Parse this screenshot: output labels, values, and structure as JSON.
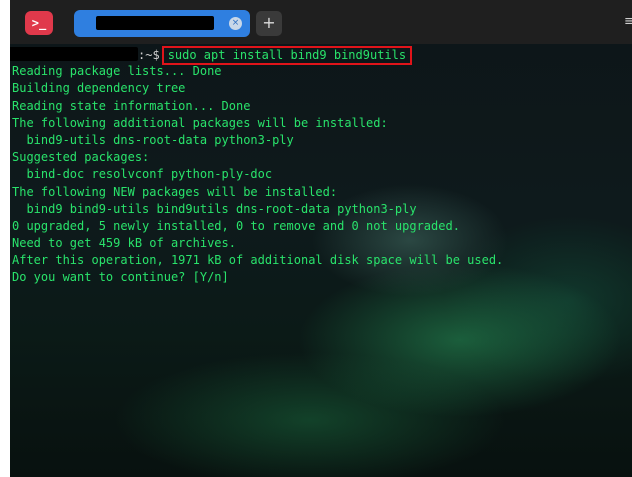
{
  "window": {
    "app_icon_glyph": ">_",
    "new_tab_glyph": "+",
    "tab_close_glyph": "×",
    "menu_glyph": "≡"
  },
  "terminal": {
    "prompt_symbol": ":~$",
    "command": "sudo apt install bind9 bind9utils",
    "output": [
      "Reading package lists... Done",
      "Building dependency tree",
      "Reading state information... Done",
      "The following additional packages will be installed:",
      "  bind9-utils dns-root-data python3-ply",
      "Suggested packages:",
      "  bind-doc resolvconf python-ply-doc",
      "The following NEW packages will be installed:",
      "  bind9 bind9-utils bind9utils dns-root-data python3-ply",
      "0 upgraded, 5 newly installed, 0 to remove and 0 not upgraded.",
      "Need to get 459 kB of archives.",
      "After this operation, 1971 kB of additional disk space will be used.",
      "Do you want to continue? [Y/n]"
    ]
  },
  "colors": {
    "terminal_text": "#29e36b",
    "tab_active": "#2f7fe0",
    "app_icon": "#e0394b",
    "command_highlight": "#e0141a"
  }
}
